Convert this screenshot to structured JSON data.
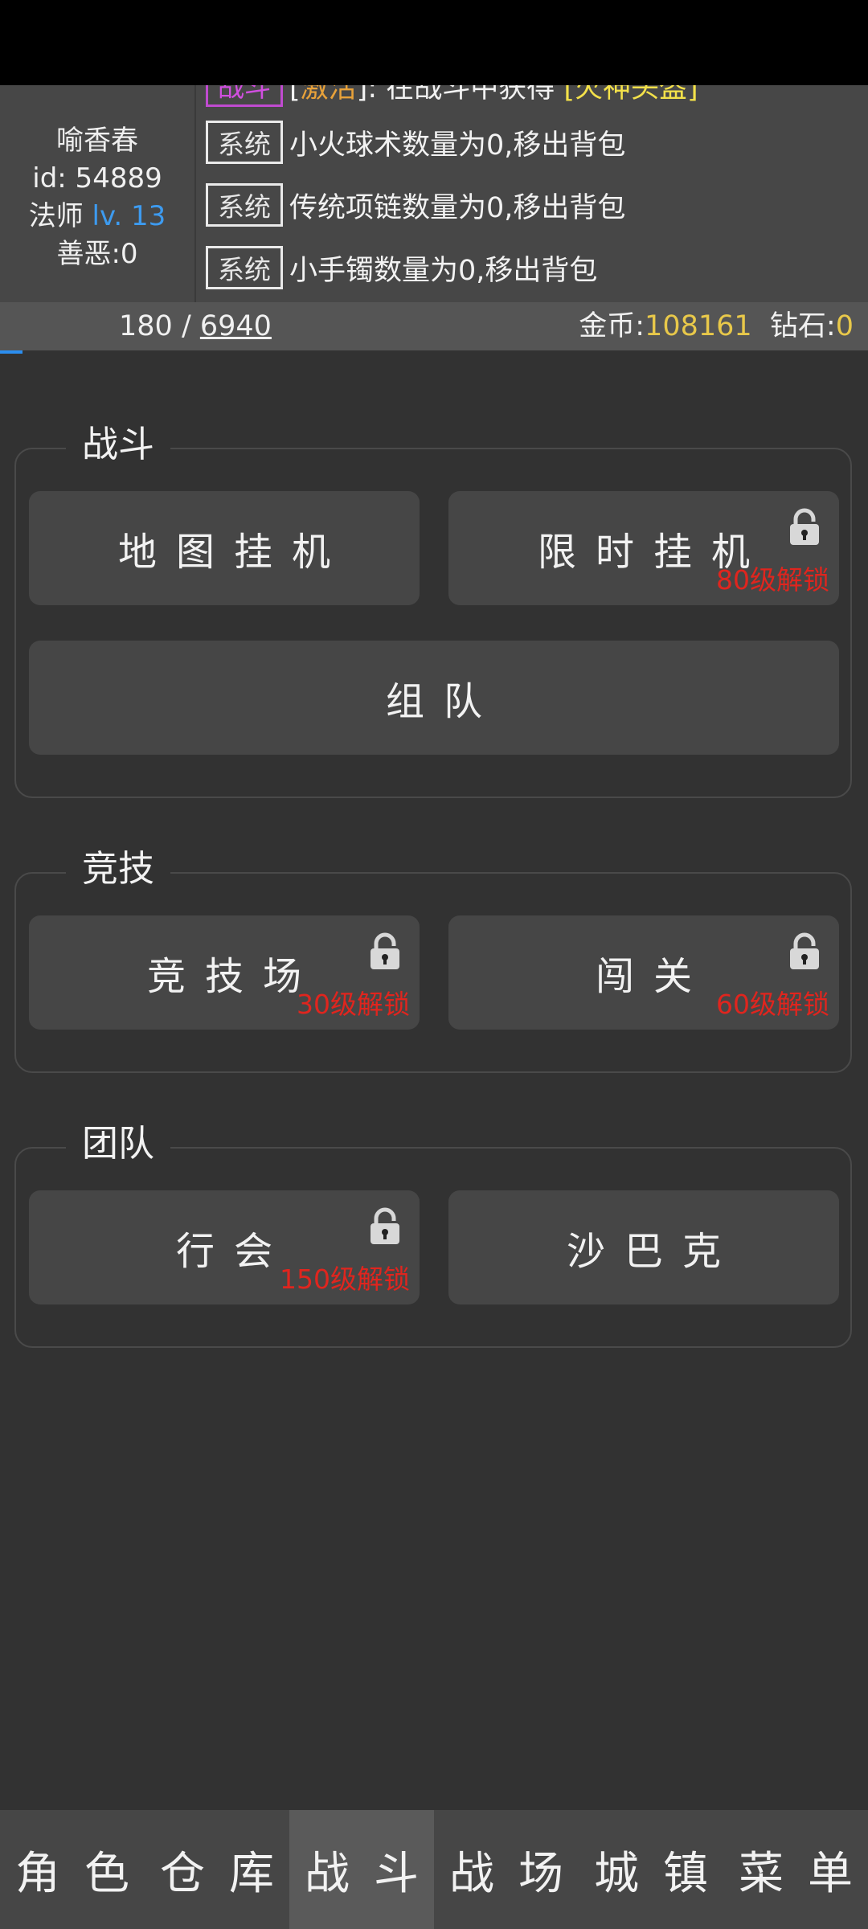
{
  "player": {
    "name": "喻香春",
    "id_text": "id: 54889",
    "class": "法师",
    "level": "lv. 13",
    "karma": "善恶:0"
  },
  "log": {
    "partial": {
      "tag": "战斗",
      "text_a": "[",
      "text_b": "激活",
      "text_c": "]: 在战斗中获得 ",
      "text_d": "[火神头盔]"
    },
    "rows": [
      {
        "tag": "系统",
        "text": "小火球术数量为0,移出背包"
      },
      {
        "tag": "系统",
        "text": "传统项链数量为0,移出背包"
      },
      {
        "tag": "系统",
        "text": "小手镯数量为0,移出背包"
      }
    ]
  },
  "resources": {
    "hp_current": "180",
    "hp_sep": " / ",
    "hp_max": "6940",
    "gold_label": "金币:",
    "gold_value": "108161",
    "diamond_label": "钻石:",
    "diamond_value": "0"
  },
  "sections": {
    "battle": {
      "title": "战斗",
      "map": "地图挂机",
      "timed": "限时挂机",
      "timed_unlock": "80级解锁",
      "team": "组队"
    },
    "arena": {
      "title": "竞技",
      "arena": "竞技场",
      "arena_unlock": "30级解锁",
      "stage": "闯关",
      "stage_unlock": "60级解锁"
    },
    "group": {
      "title": "团队",
      "guild": "行会",
      "guild_unlock": "150级解锁",
      "sabak": "沙巴克"
    }
  },
  "tabs": [
    "角色",
    "仓库",
    "战斗",
    "战场",
    "城镇",
    "菜单"
  ],
  "active_tab": "战斗",
  "colors": {
    "level": "#3d9bf0",
    "gold": "#e8c84a",
    "lock_text": "#e0251e",
    "active_tab": "#5a5a5a"
  },
  "icons": {
    "lock": "padlock-icon"
  }
}
